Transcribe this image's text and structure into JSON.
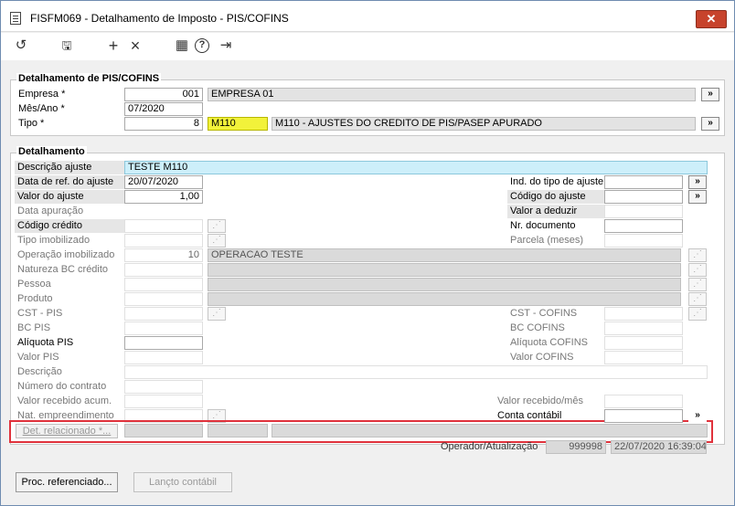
{
  "window": {
    "title": "FISFM069 - Detalhamento de Imposto - PIS/COFINS",
    "close": "✕"
  },
  "toolbar": {
    "undo": "↺",
    "save": "🖫",
    "add": "+",
    "cancel": "×",
    "calendar": "▦",
    "help": "?",
    "exit": "⇥"
  },
  "header": {
    "legend": "Detalhamento de PIS/COFINS",
    "empresa_label": "Empresa *",
    "empresa_code": "001",
    "empresa_name": "EMPRESA 01",
    "mesano_label": "Mês/Ano *",
    "mesano_value": "07/2020",
    "tipo_label": "Tipo *",
    "tipo_code": "8",
    "tipo_short": "M110",
    "tipo_desc": "M110 - AJUSTES DO CREDITO DE PIS/PASEP APURADO",
    "lookup": "»"
  },
  "det": {
    "legend": "Detalhamento",
    "descricao_ajuste_label": "Descrição ajuste",
    "descricao_ajuste_value": "TESTE M110",
    "data_ref_label": "Data de ref. do ajuste",
    "data_ref_value": "20/07/2020",
    "valor_ajuste_label": "Valor do ajuste",
    "valor_ajuste_value": "1,00",
    "data_apuracao_label": "Data apuração",
    "codigo_credito_label": "Código crédito",
    "tipo_imobilizado_label": "Tipo imobilizado",
    "operacao_imob_label": "Operação imobilizado",
    "operacao_imob_code": "10",
    "operacao_imob_name": "OPERACAO TESTE",
    "natureza_bc_label": "Natureza BC crédito",
    "pessoa_label": "Pessoa",
    "produto_label": "Produto",
    "cst_pis_label": "CST - PIS",
    "bc_pis_label": "BC PIS",
    "aliquota_pis_label": "Alíquota PIS",
    "valor_pis_label": "Valor PIS",
    "descricao_label": "Descrição",
    "numero_contrato_label": "Número do contrato",
    "valor_recebido_acum_label": "Valor recebido acum.",
    "nat_empreendimento_label": "Nat. empreendimento",
    "det_relacionado_label": "Det. relacionado *...",
    "ind_tipo_ajuste_label": "Ind. do tipo de ajuste",
    "codigo_ajuste_label": "Código do ajuste",
    "valor_deduzir_label": "Valor a deduzir",
    "nr_documento_label": "Nr. documento",
    "parcela_label": "Parcela (meses)",
    "cst_cofins_label": "CST - COFINS",
    "bc_cofins_label": "BC COFINS",
    "aliquota_cofins_label": "Alíquota COFINS",
    "valor_cofins_label": "Valor COFINS",
    "valor_recebido_mes_label": "Valor recebido/mês",
    "conta_contabil_label": "Conta contábil",
    "lookup": "»",
    "lookup_disabled": "⋰"
  },
  "footer": {
    "operador_label": "Operador/Atualização",
    "operador_value": "999998",
    "atualizacao_value": "22/07/2020 16:39:04",
    "proc_button": "Proc. referenciado...",
    "lancto_button": "Lançto contábil"
  }
}
